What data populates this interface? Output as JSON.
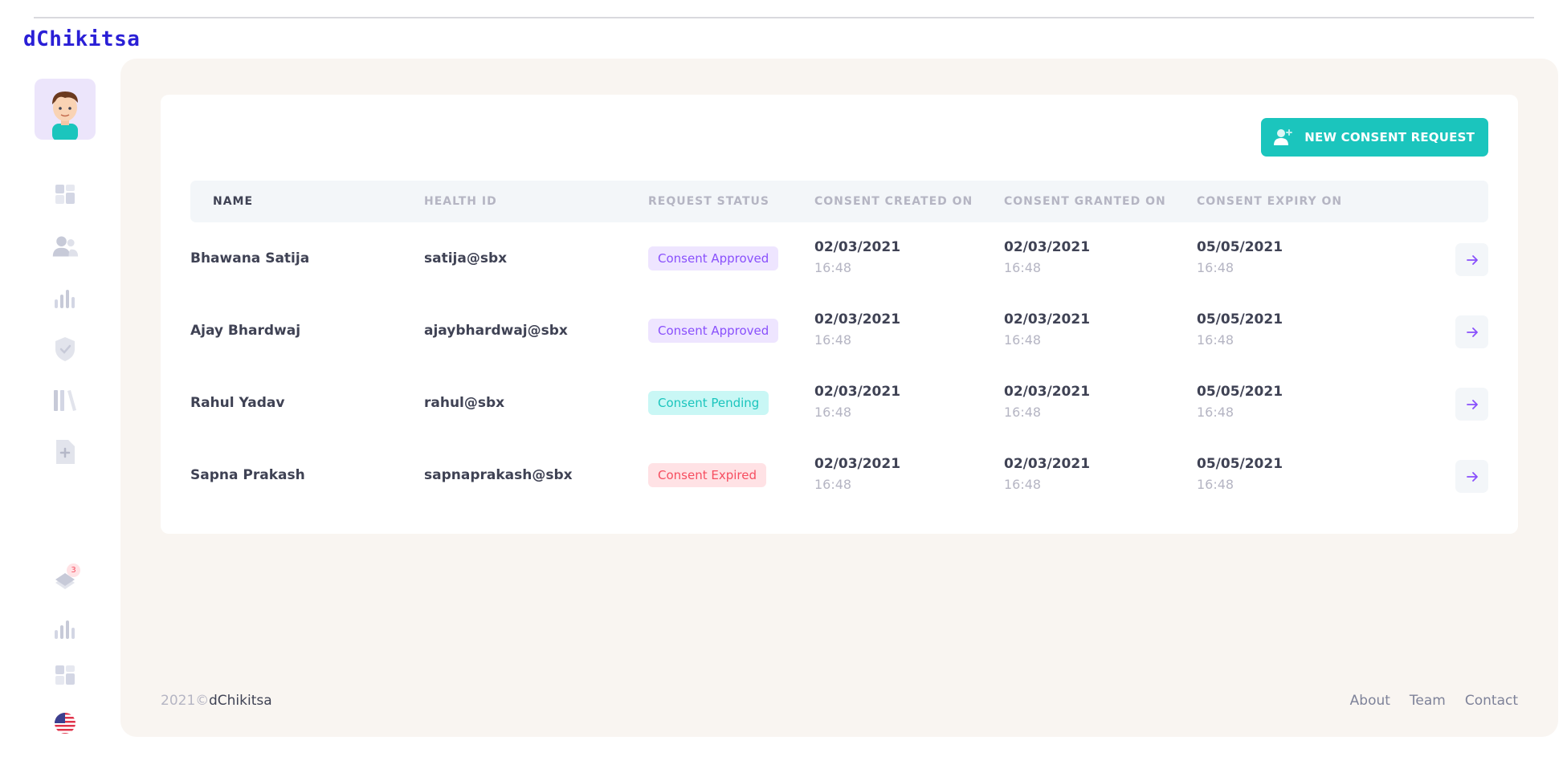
{
  "app": {
    "brand": "dChikitsa"
  },
  "sidebar": {
    "items": [
      {
        "name": "dashboard-icon"
      },
      {
        "name": "users-icon"
      },
      {
        "name": "analytics-icon"
      },
      {
        "name": "shield-icon"
      },
      {
        "name": "library-icon"
      },
      {
        "name": "add-file-icon"
      }
    ],
    "bottom": {
      "notifications_count": "3"
    }
  },
  "toolbar": {
    "new_request_label": "NEW CONSENT REQUEST"
  },
  "table": {
    "columns": [
      "NAME",
      "HEALTH ID",
      "REQUEST STATUS",
      "CONSENT CREATED ON",
      "CONSENT GRANTED ON",
      "CONSENT EXPIRY ON"
    ],
    "rows": [
      {
        "name": "Bhawana Satija",
        "health_id": "satija@sbx",
        "status": "Consent Approved",
        "status_type": "approved",
        "created_date": "02/03/2021",
        "created_time": "16:48",
        "granted_date": "02/03/2021",
        "granted_time": "16:48",
        "expiry_date": "05/05/2021",
        "expiry_time": "16:48"
      },
      {
        "name": "Ajay Bhardwaj",
        "health_id": "ajaybhardwaj@sbx",
        "status": "Consent Approved",
        "status_type": "approved",
        "created_date": "02/03/2021",
        "created_time": "16:48",
        "granted_date": "02/03/2021",
        "granted_time": "16:48",
        "expiry_date": "05/05/2021",
        "expiry_time": "16:48"
      },
      {
        "name": "Rahul Yadav",
        "health_id": "rahul@sbx",
        "status": "Consent Pending",
        "status_type": "pending",
        "created_date": "02/03/2021",
        "created_time": "16:48",
        "granted_date": "02/03/2021",
        "granted_time": "16:48",
        "expiry_date": "05/05/2021",
        "expiry_time": "16:48"
      },
      {
        "name": "Sapna Prakash",
        "health_id": "sapnaprakash@sbx",
        "status": "Consent Expired",
        "status_type": "expired",
        "created_date": "02/03/2021",
        "created_time": "16:48",
        "granted_date": "02/03/2021",
        "granted_time": "16:48",
        "expiry_date": "05/05/2021",
        "expiry_time": "16:48"
      }
    ]
  },
  "footer": {
    "copyright": "2021©",
    "brand": "dChikitsa",
    "links": [
      "About",
      "Team",
      "Contact"
    ]
  },
  "colors": {
    "accent": "#1bc5bd",
    "brand": "#2a1fd6",
    "approved": "#8950fc",
    "pending": "#1bc5bd",
    "expired": "#f64e60"
  }
}
